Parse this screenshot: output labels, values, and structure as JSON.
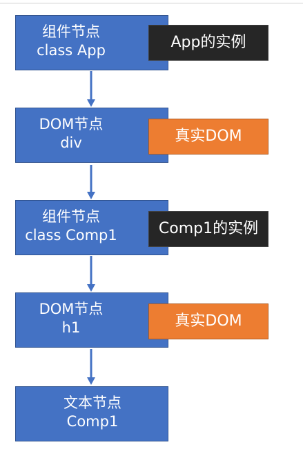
{
  "nodes": [
    {
      "line1": "组件节点",
      "line2": "class App"
    },
    {
      "line1": "DOM节点",
      "line2": "div"
    },
    {
      "line1": "组件节点",
      "line2": "class Comp1"
    },
    {
      "line1": "DOM节点",
      "line2": "h1"
    },
    {
      "line1": "文本节点",
      "line2": "Comp1"
    }
  ],
  "tags": [
    {
      "text": "App的实例",
      "color": "#262626"
    },
    {
      "text": "真实DOM",
      "color": "#ed7d31"
    },
    {
      "text": "Comp1的实例",
      "color": "#262626"
    },
    {
      "text": "真实DOM",
      "color": "#ed7d31"
    }
  ],
  "colors": {
    "node_fill": "#4472c4",
    "arrow": "#4472c4"
  }
}
